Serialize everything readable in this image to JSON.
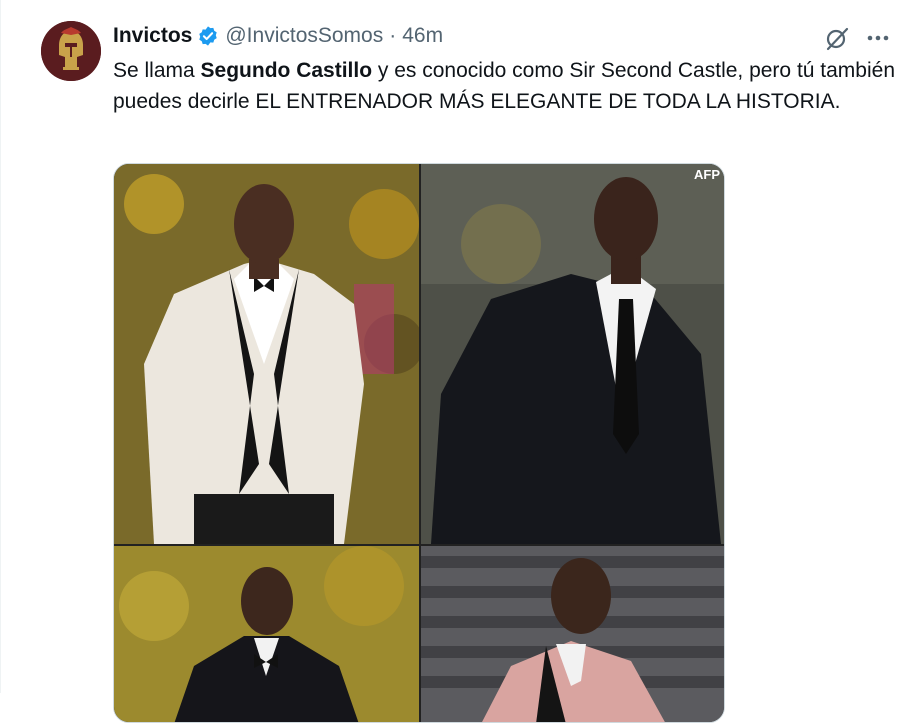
{
  "tweet": {
    "author_name": "Invictos",
    "handle": "@InvictosSomos",
    "separator": "·",
    "time": "46m",
    "text_intro": "Se llama ",
    "text_bold": "Segundo Castillo",
    "text_rest": " y es conocido como Sir Second Castle, pero tú también puedes decirle EL ENTRENADOR MÁS ELEGANTE DE TODA LA HISTORIA.",
    "avatar_icon": "helmet-logo-icon",
    "verified_icon": "verified-badge-icon",
    "grok_icon": "grok-icon",
    "more_icon": "more-options-icon"
  },
  "media": {
    "photo_credit": "AFP",
    "photos": [
      {
        "alt": "coach in white tuxedo"
      },
      {
        "alt": "coach in black suit"
      },
      {
        "alt": "coach in black tuxedo"
      },
      {
        "alt": "coach in pink jacket"
      }
    ]
  },
  "colors": {
    "text": "#0f1419",
    "muted": "#536471",
    "verified_blue": "#1d9bf0",
    "avatar_bg": "#5a1c1f"
  }
}
